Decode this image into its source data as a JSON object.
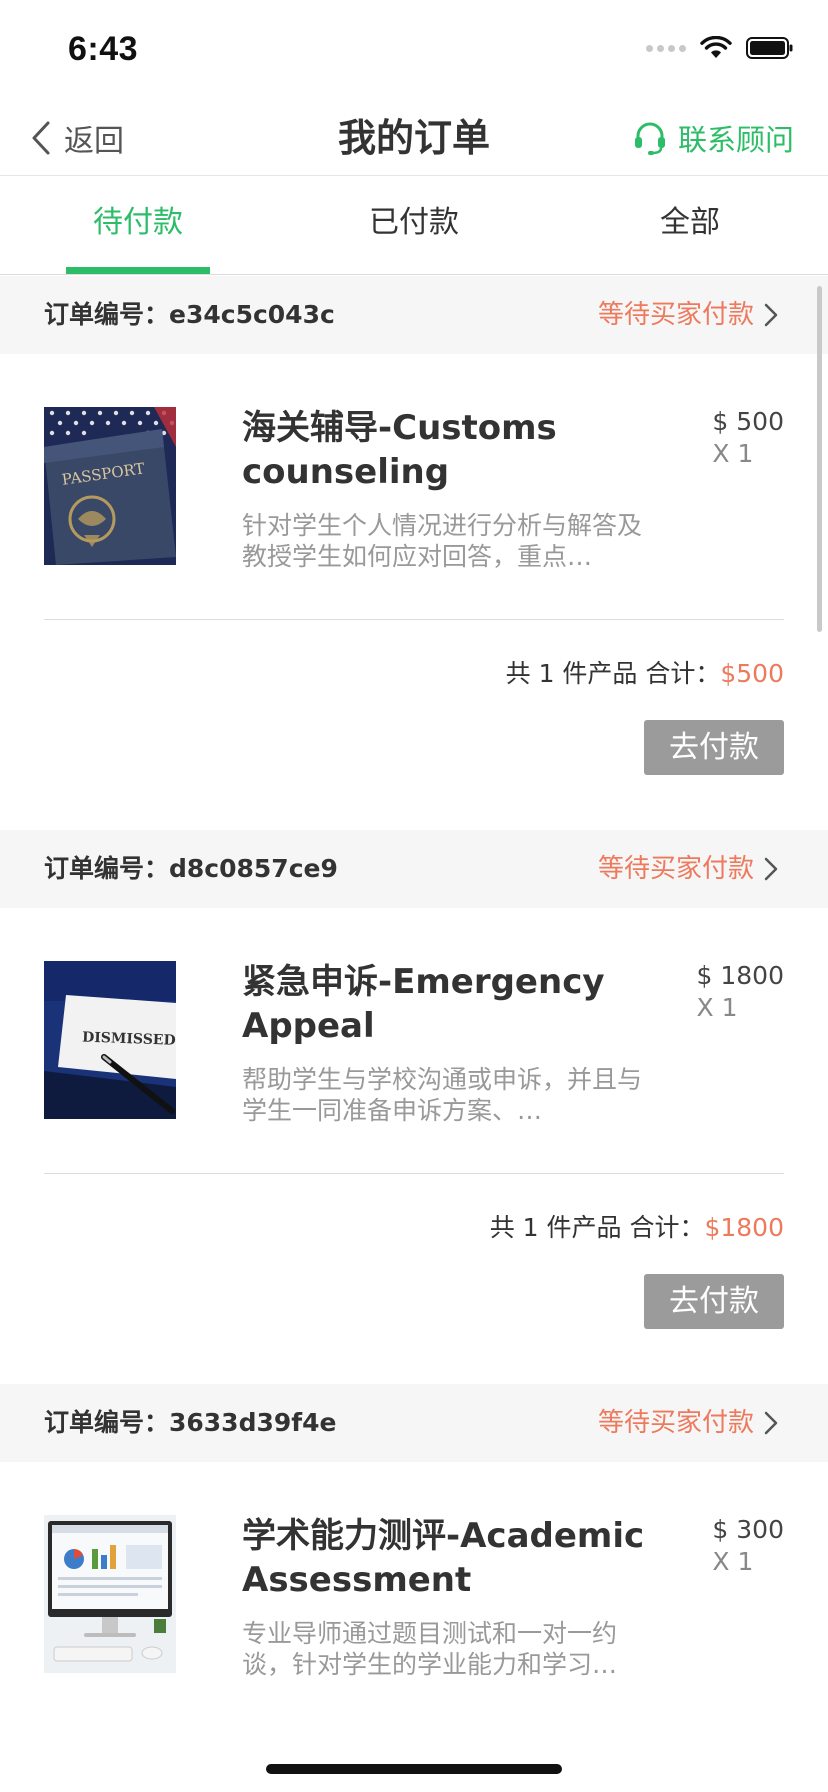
{
  "status_bar": {
    "time": "6:43"
  },
  "nav": {
    "back_label": "返回",
    "title": "我的订单",
    "contact_label": "联系顾问"
  },
  "tabs": [
    {
      "label": "待付款",
      "active": true
    },
    {
      "label": "已付款",
      "active": false
    },
    {
      "label": "全部",
      "active": false
    }
  ],
  "orders": [
    {
      "id_label": "订单编号：e34c5c043c",
      "status": "等待买家付款",
      "product_title": "海关辅导-Customs counseling",
      "product_desc": "针对学生个人情况进行分析与解答及教授学生如何应对回答，重点…",
      "price": "$ 500",
      "qty": "X 1",
      "summary_prefix": "共 1 件产品 合计：",
      "total": "$500",
      "pay_label": "去付款",
      "image": "passport"
    },
    {
      "id_label": "订单编号：d8c0857ce9",
      "status": "等待买家付款",
      "product_title": "紧急申诉-Emergency Appeal",
      "product_desc": "帮助学生与学校沟通或申诉，并且与学生一同准备申诉方案、…",
      "price": "$ 1800",
      "qty": "X 1",
      "summary_prefix": "共 1 件产品 合计：",
      "total": "$1800",
      "pay_label": "去付款",
      "image": "dismissed",
      "image_text": "DISMISSED"
    },
    {
      "id_label": "订单编号：3633d39f4e",
      "status": "等待买家付款",
      "product_title": "学术能力测评-Academic Assessment",
      "product_desc": "专业导师通过题目测试和一对一约谈，针对学生的学业能力和学习…",
      "price": "$ 300",
      "qty": "X 1",
      "image": "computer"
    }
  ],
  "passport_text": "PASSPORT",
  "colors": {
    "accent": "#2dbd68",
    "status": "#ee7a5d",
    "pay_button": "#9b9b9b"
  }
}
